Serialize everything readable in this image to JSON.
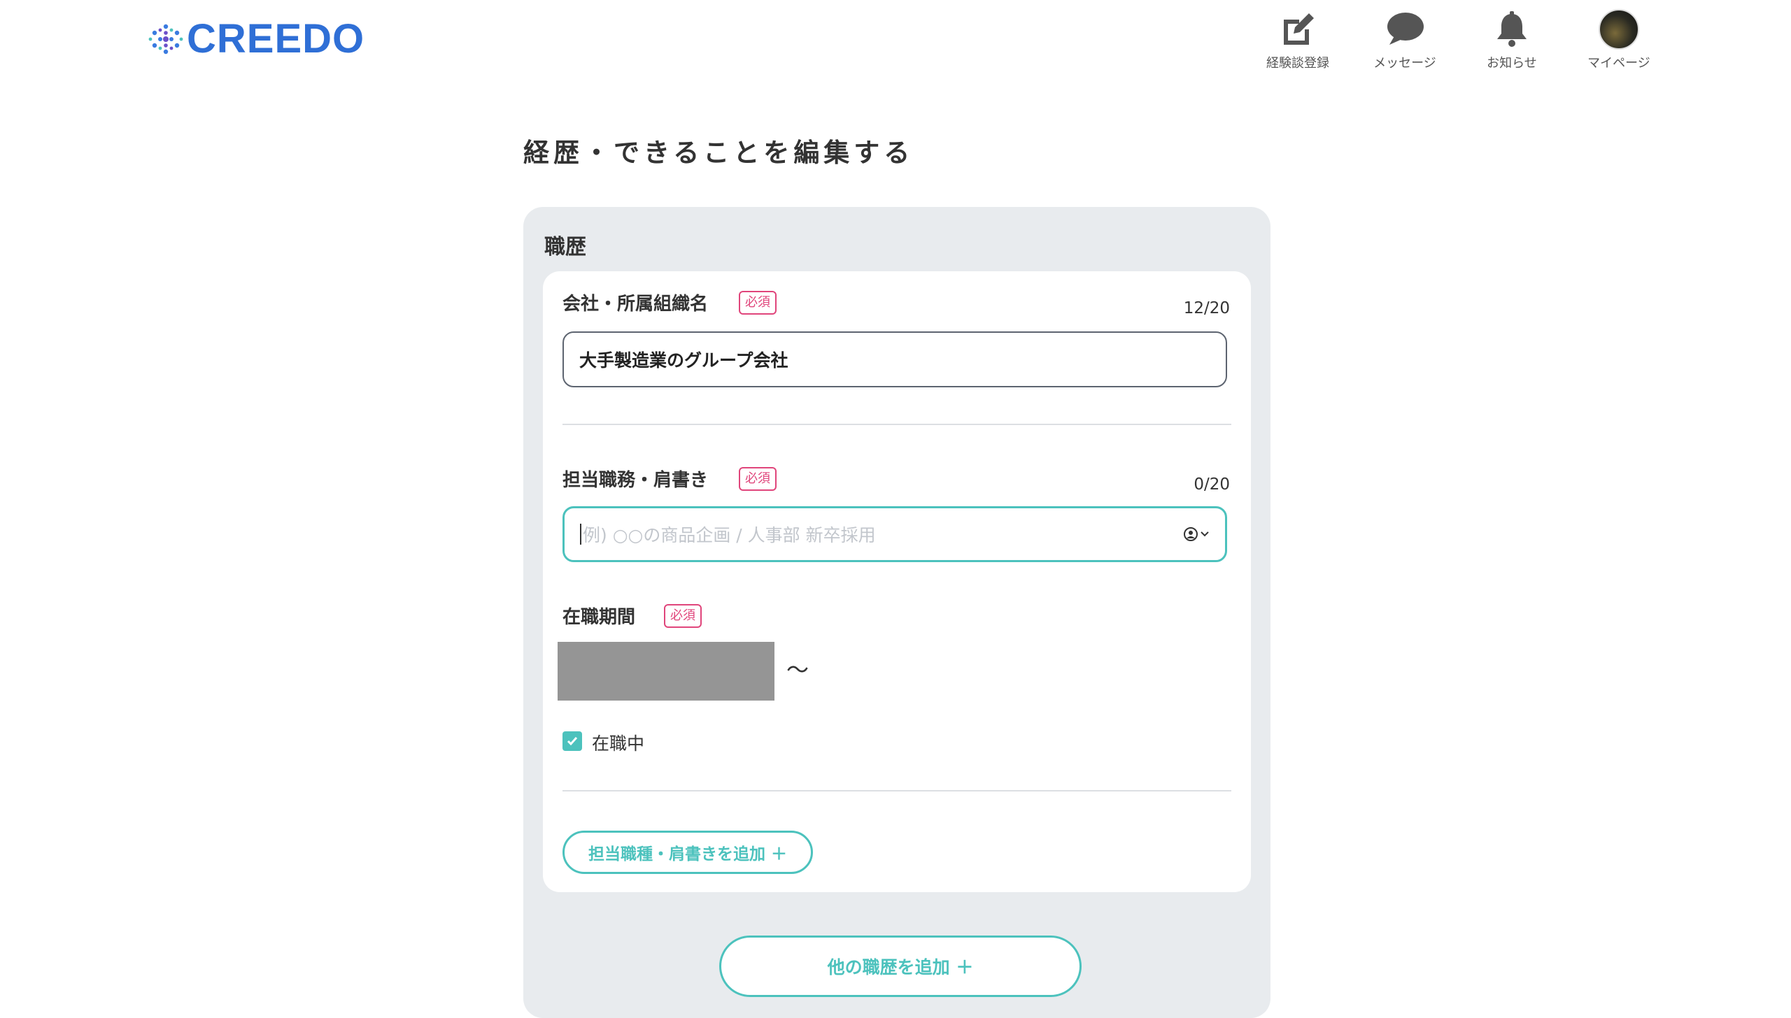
{
  "header": {
    "logo_text": "CREEDO",
    "nav": [
      {
        "label": "経験談登録",
        "icon": "edit-icon"
      },
      {
        "label": "メッセージ",
        "icon": "chat-icon"
      },
      {
        "label": "お知らせ",
        "icon": "bell-icon"
      },
      {
        "label": "マイページ",
        "icon": "avatar"
      }
    ]
  },
  "page": {
    "title": "経歴・できることを編集する"
  },
  "career": {
    "section_title": "職歴",
    "required_badge": "必須",
    "company": {
      "label": "会社・所属組織名",
      "count": "12/20",
      "value": "大手製造業のグループ会社"
    },
    "position": {
      "label": "担当職務・肩書き",
      "count": "0/20",
      "placeholder": "例) ○○の商品企画 / 人事部 新卒採用"
    },
    "period": {
      "label": "在職期間",
      "separator": "〜",
      "currently_employed_label": "在職中",
      "currently_employed": true
    },
    "add_position_label": "担当職種・肩書きを追加 ＋",
    "add_career_label": "他の職歴を追加 ＋"
  },
  "colors": {
    "accent": "#4cc2bd",
    "brand": "#2f6fd6",
    "required": "#e0457b",
    "panel_bg": "#e8ebee"
  }
}
